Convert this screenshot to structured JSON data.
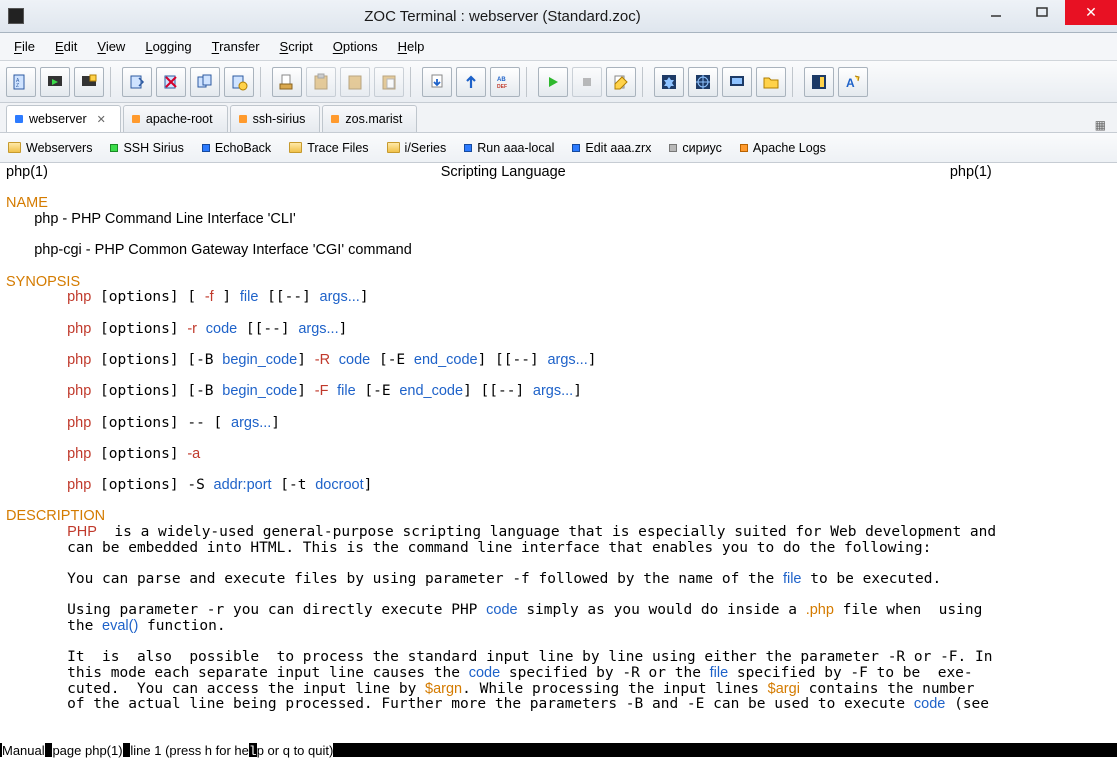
{
  "window": {
    "title": "ZOC Terminal : webserver (Standard.zoc)"
  },
  "menu": [
    "File",
    "Edit",
    "View",
    "Logging",
    "Transfer",
    "Script",
    "Options",
    "Help"
  ],
  "tabs": [
    {
      "label": "webserver",
      "color": "#2d7bff",
      "active": true,
      "closeable": true
    },
    {
      "label": "apache-root",
      "color": "#ff9a2d"
    },
    {
      "label": "ssh-sirius",
      "color": "#ff9a2d"
    },
    {
      "label": "zos.marist",
      "color": "#ff9a2d"
    }
  ],
  "bookmarks": [
    {
      "label": "Webservers",
      "ic": "folder"
    },
    {
      "label": "SSH Sirius",
      "ic": "sq-g"
    },
    {
      "label": "EchoBack",
      "ic": "sq-b"
    },
    {
      "label": "Trace Files",
      "ic": "folder"
    },
    {
      "label": "i/Series",
      "ic": "folder"
    },
    {
      "label": "Run aaa-local",
      "ic": "sq-b"
    },
    {
      "label": "Edit aaa.zrx",
      "ic": "sq-b"
    },
    {
      "label": "сириус",
      "ic": "sq-gr"
    },
    {
      "label": "Apache Logs",
      "ic": "sq-o"
    }
  ],
  "man": {
    "left": "php(1)",
    "center": "Scripting Language",
    "right": "php(1)",
    "name_hdr": "NAME",
    "name1": "       php - PHP Command Line Interface 'CLI'",
    "name2": "       php-cgi - PHP Common Gateway Interface 'CGI' command",
    "syn_hdr": "SYNOPSIS",
    "desc_hdr": "DESCRIPTION",
    "status": "Manual page php(1) line 1 (press h for help or q to quit)"
  }
}
